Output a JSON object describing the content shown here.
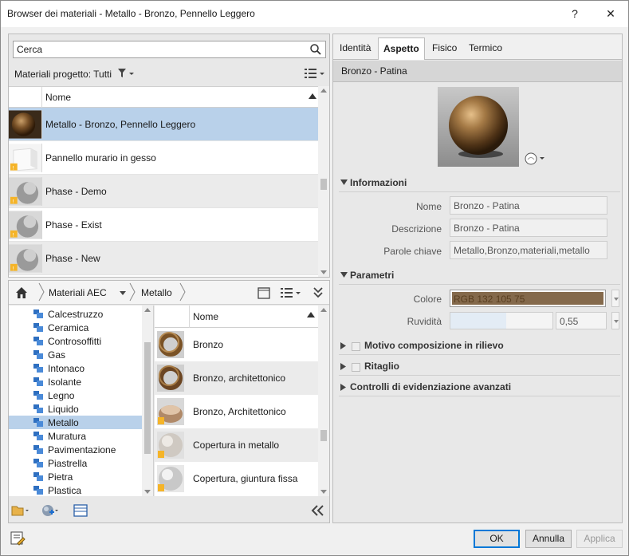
{
  "window": {
    "title": "Browser dei materiali - Metallo - Bronzo, Pennello Leggero",
    "help": "?",
    "close": "✕"
  },
  "search": {
    "value": "Cerca"
  },
  "project": {
    "label": "Materiali progetto: Tutti",
    "column": "Nome",
    "materials": [
      {
        "name": "Metallo - Bronzo, Pennello Leggero",
        "thumb": "bronze-sphere",
        "selected": true
      },
      {
        "name": "Pannello murario in gesso",
        "thumb": "white-cube"
      },
      {
        "name": "Phase - Demo",
        "thumb": "grey-sphere"
      },
      {
        "name": "Phase - Exist",
        "thumb": "grey-sphere"
      },
      {
        "name": "Phase - New",
        "thumb": "grey-sphere"
      }
    ]
  },
  "library": {
    "breadcrumb": [
      "Materiali AEC",
      "Metallo"
    ],
    "categories": [
      "Calcestruzzo",
      "Ceramica",
      "Controsoffitti",
      "Gas",
      "Intonaco",
      "Isolante",
      "Legno",
      "Liquido",
      "Metallo",
      "Muratura",
      "Pavimentazione",
      "Piastrella",
      "Pietra",
      "Plastica"
    ],
    "selected_category": "Metallo",
    "column": "Nome",
    "items": [
      {
        "name": "Bronzo",
        "thumb": "bronze-ring"
      },
      {
        "name": "Bronzo, architettonico",
        "thumb": "bronze-ring"
      },
      {
        "name": "Bronzo, Architettonico",
        "thumb": "bronze-shape"
      },
      {
        "name": "Copertura in metallo",
        "thumb": "light-sphere"
      },
      {
        "name": "Copertura, giuntura fissa",
        "thumb": "light-sphere"
      }
    ]
  },
  "tabs": [
    "Identità",
    "Aspetto",
    "Fisico",
    "Termico"
  ],
  "active_tab": "Aspetto",
  "asset": {
    "name": "Bronzo - Patina"
  },
  "informazioni": {
    "title": "Informazioni",
    "nome_label": "Nome",
    "nome": "Bronzo - Patina",
    "descrizione_label": "Descrizione",
    "descrizione": "Bronzo - Patina",
    "parole_label": "Parole chiave",
    "parole": "Metallo,Bronzo,materiali,metallo"
  },
  "parametri": {
    "title": "Parametri",
    "colore_label": "Colore",
    "colore": "RGB 132 105 75",
    "colore_hex": "#84694b",
    "ruvidita_label": "Ruvidità",
    "ruvidita": "0,55",
    "ruvidita_fraction": 0.55
  },
  "sections": [
    "Motivo composizione in rilievo",
    "Ritaglio",
    "Controlli di evidenziazione avanzati"
  ],
  "footer": {
    "ok": "OK",
    "annulla": "Annulla",
    "applica": "Applica"
  }
}
